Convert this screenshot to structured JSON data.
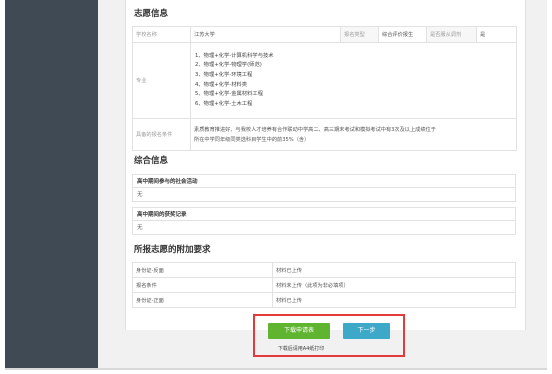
{
  "volunteer_info": {
    "title": "志愿信息",
    "school_label": "学校名称",
    "school_value": "江苏大学",
    "enroll_type_label": "报名类型",
    "enroll_type_value": "综合评价报生",
    "adjust_label": "是否服从调剂",
    "adjust_value": "是",
    "major_label": "专业",
    "majors": [
      "1、物理+化学-计算机科学与技术",
      "2、物理+化学-物理学(师范)",
      "3、物理+化学-环境工程",
      "4、物理+化学-材料类",
      "5、物理+化学-金属材料工程",
      "6、物理+化学-土木工程"
    ],
    "condition_label": "具备的报名条件",
    "condition_line1": "素质教育推进好、与我校人才培养有合作联动中学高二、高三期末考试和模拟考试中有3次及以上成绩位于",
    "condition_line2": "所在中学同年级同类选科目学生中的前35%（含）"
  },
  "overall_info": {
    "title": "综合信息",
    "social_label": "高中期间参与的社会活动",
    "social_value": "无",
    "award_label": "高中期间的获奖记录",
    "award_value": "无"
  },
  "extra_requirements": {
    "title": "所报志愿的附加要求",
    "rows": [
      {
        "label": "身份证-反面",
        "value": "材料已上传"
      },
      {
        "label": "报名条件",
        "value": "材料未上传（此项为非必填项）"
      },
      {
        "label": "身份证-正面",
        "value": "材料已上传"
      }
    ]
  },
  "actions": {
    "download_label": "下载申请表",
    "next_label": "下一步",
    "hint": "下载后请用A4纸打印"
  },
  "colors": {
    "sidebar": "#3f4a55",
    "download_button": "#5fb52f",
    "next_button": "#3ea8c9",
    "highlight_border": "#e23b3b"
  }
}
